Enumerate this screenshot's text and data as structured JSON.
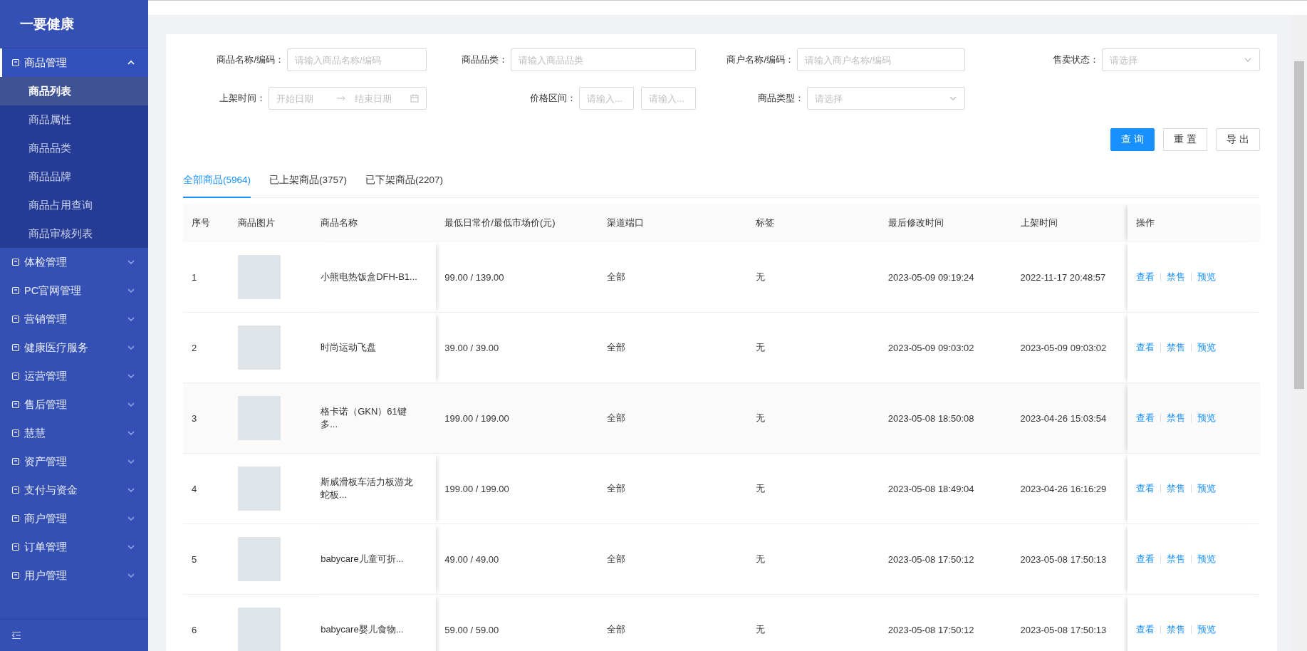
{
  "sidebar": {
    "logo": "一要健康",
    "menu": [
      {
        "label": "商品管理",
        "expanded": true,
        "children": [
          {
            "label": "商品列表",
            "selected": true
          },
          {
            "label": "商品属性",
            "selected": false
          },
          {
            "label": "商品品类",
            "selected": false
          },
          {
            "label": "商品品牌",
            "selected": false
          },
          {
            "label": "商品占用查询",
            "selected": false
          },
          {
            "label": "商品审核列表",
            "selected": false
          }
        ]
      },
      {
        "label": "体检管理",
        "expanded": false
      },
      {
        "label": "PC官网管理",
        "expanded": false
      },
      {
        "label": "营销管理",
        "expanded": false
      },
      {
        "label": "健康医疗服务",
        "expanded": false
      },
      {
        "label": "运营管理",
        "expanded": false
      },
      {
        "label": "售后管理",
        "expanded": false
      },
      {
        "label": "慧慧",
        "expanded": false
      },
      {
        "label": "资产管理",
        "expanded": false
      },
      {
        "label": "支付与资金",
        "expanded": false
      },
      {
        "label": "商户管理",
        "expanded": false
      },
      {
        "label": "订单管理",
        "expanded": false
      },
      {
        "label": "用户管理",
        "expanded": false
      }
    ]
  },
  "filters": [
    {
      "kind": "text",
      "label": "商品名称/编码：",
      "placeholder": "请输入商品名称/编码"
    },
    {
      "kind": "text",
      "label": "商品品类：",
      "placeholder": "请输入商品品类"
    },
    {
      "kind": "text",
      "label": "商户名称/编码：",
      "placeholder": "请输入商户名称/编码"
    },
    {
      "kind": "select",
      "label": "售卖状态：",
      "placeholder": "请选择"
    },
    {
      "kind": "daterange",
      "label": "上架时间：",
      "start_placeholder": "开始日期",
      "end_placeholder": "结束日期"
    },
    {
      "kind": "range",
      "label": "价格区间：",
      "min_placeholder": "请输入...",
      "max_placeholder": "请输入..."
    },
    {
      "kind": "select",
      "label": "商品类型：",
      "placeholder": "请选择"
    }
  ],
  "buttons": [
    {
      "label": "查 询",
      "primary": true
    },
    {
      "label": "重 置",
      "primary": false
    },
    {
      "label": "导 出",
      "primary": false
    }
  ],
  "tabs": [
    {
      "label": "全部商品(5964)",
      "selected": true
    },
    {
      "label": "已上架商品(3757)",
      "selected": false
    },
    {
      "label": "已下架商品(2207)",
      "selected": false
    }
  ],
  "table": {
    "columns": [
      "序号",
      "商品图片",
      "商品名称",
      "最低日常价/最低市场价(元)",
      "渠道端口",
      "标签",
      "最后修改时间",
      "上架时间",
      "操作"
    ],
    "rows": [
      {
        "index": "1",
        "name": "小熊电热饭盒DFH-B1...",
        "price": "99.00 / 139.00",
        "channel": "全部",
        "tag": "无",
        "modified": "2023-05-09 09:19:24",
        "listed": "2022-11-17 20:48:57",
        "actions": [
          "查看",
          "禁售",
          "预览"
        ]
      },
      {
        "index": "2",
        "name": "时尚运动飞盘",
        "price": "39.00 / 39.00",
        "channel": "全部",
        "tag": "无",
        "modified": "2023-05-09 09:03:02",
        "listed": "2023-05-09 09:03:02",
        "actions": [
          "查看",
          "禁售",
          "预览"
        ]
      },
      {
        "index": "3",
        "name": "格卡诺（GKN）61键多...",
        "price": "199.00 / 199.00",
        "channel": "全部",
        "tag": "无",
        "modified": "2023-05-08 18:50:08",
        "listed": "2023-04-26 15:03:54",
        "actions": [
          "查看",
          "禁售",
          "预览"
        ]
      },
      {
        "index": "4",
        "name": "斯威滑板车活力板游龙蛇板...",
        "price": "199.00 / 199.00",
        "channel": "全部",
        "tag": "无",
        "modified": "2023-05-08 18:49:04",
        "listed": "2023-04-26 16:16:29",
        "actions": [
          "查看",
          "禁售",
          "预览"
        ]
      },
      {
        "index": "5",
        "name": "babycare儿童可折...",
        "price": "49.00 / 49.00",
        "channel": "全部",
        "tag": "无",
        "modified": "2023-05-08 17:50:12",
        "listed": "2023-05-08 17:50:13",
        "actions": [
          "查看",
          "禁售",
          "预览"
        ]
      },
      {
        "index": "6",
        "name": "babycare婴儿食物...",
        "price": "59.00 / 59.00",
        "channel": "全部",
        "tag": "无",
        "modified": "2023-05-08 17:50:12",
        "listed": "2023-05-08 17:50:13",
        "actions": [
          "查看",
          "禁售",
          "预览"
        ]
      }
    ]
  }
}
